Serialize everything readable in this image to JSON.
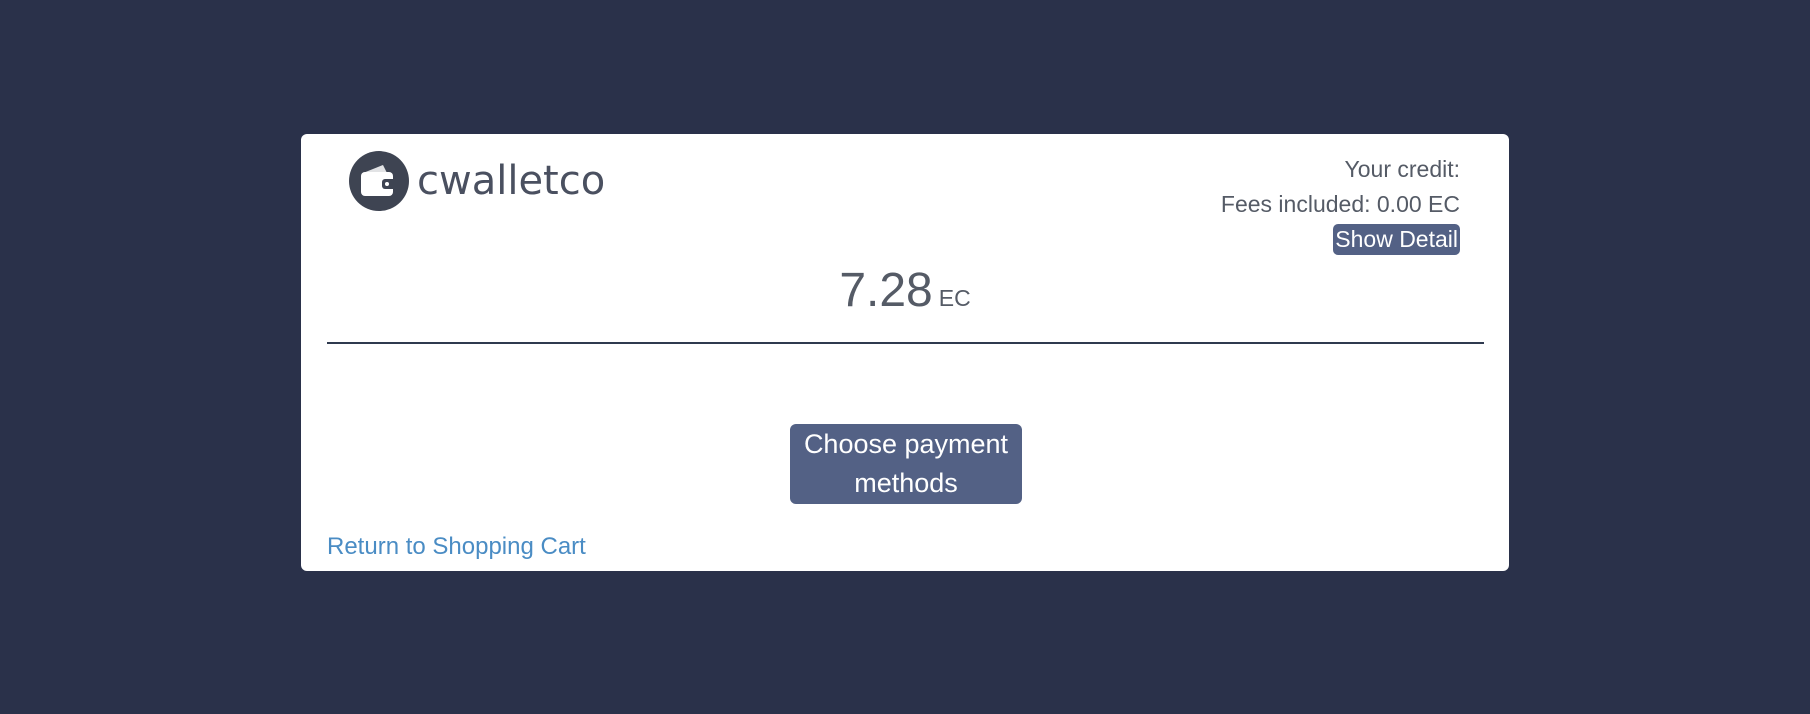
{
  "brand": {
    "logo_text": "cwalletco",
    "logo_icon": "wallet-icon"
  },
  "credit": {
    "your_credit_label": "Your credit:",
    "fees_label": "Fees included: 0.00 EC",
    "show_detail_label": "Show Detail"
  },
  "amount": {
    "value": "7.28",
    "unit": "EC"
  },
  "actions": {
    "choose_payment_label": "Choose payment methods",
    "return_link_label": "Return to Shopping Cart"
  },
  "colors": {
    "page_background": "#2a314a",
    "card_background": "#ffffff",
    "button_background": "#536185",
    "link_color": "#4a8cc4",
    "text_color": "#555b66"
  }
}
